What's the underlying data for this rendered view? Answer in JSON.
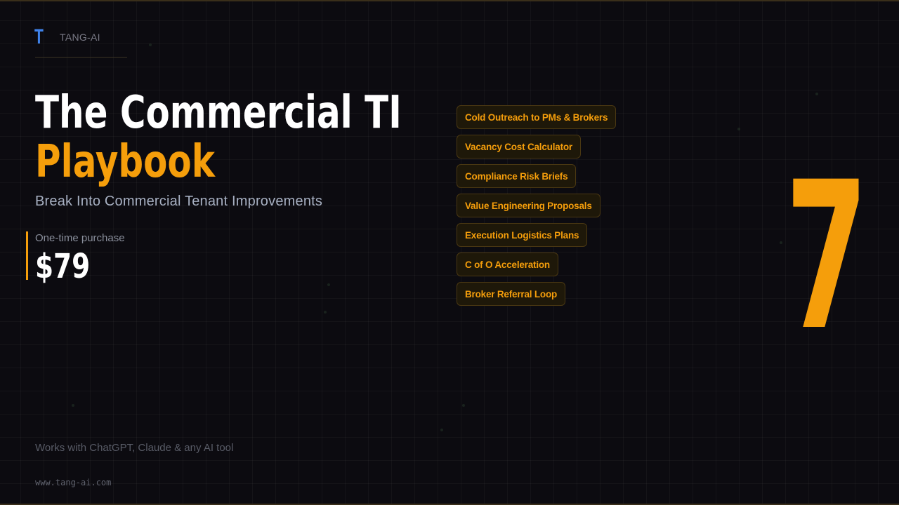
{
  "brand": {
    "logo_letter": "T",
    "name": "TANG-AI"
  },
  "hero": {
    "title_line1": "The Commercial TI",
    "title_line2": "Playbook",
    "subtitle": "Break Into Commercial Tenant Improvements"
  },
  "pricing": {
    "caption": "One-time purchase",
    "price": "$79"
  },
  "modules": [
    "Cold Outreach to PMs & Brokers",
    "Vacancy Cost Calculator",
    "Compliance Risk Briefs",
    "Value Engineering Proposals",
    "Execution Logistics Plans",
    "C of O Acceleration",
    "Broker Referral Loop"
  ],
  "module_count": "7",
  "footer": {
    "compatibility": "Works with ChatGPT, Claude & any AI tool",
    "url": "www.tang-ai.com"
  },
  "colors": {
    "accent": "#f59e0b",
    "logo_blue": "#3f82ea",
    "background": "#0c0b10"
  }
}
